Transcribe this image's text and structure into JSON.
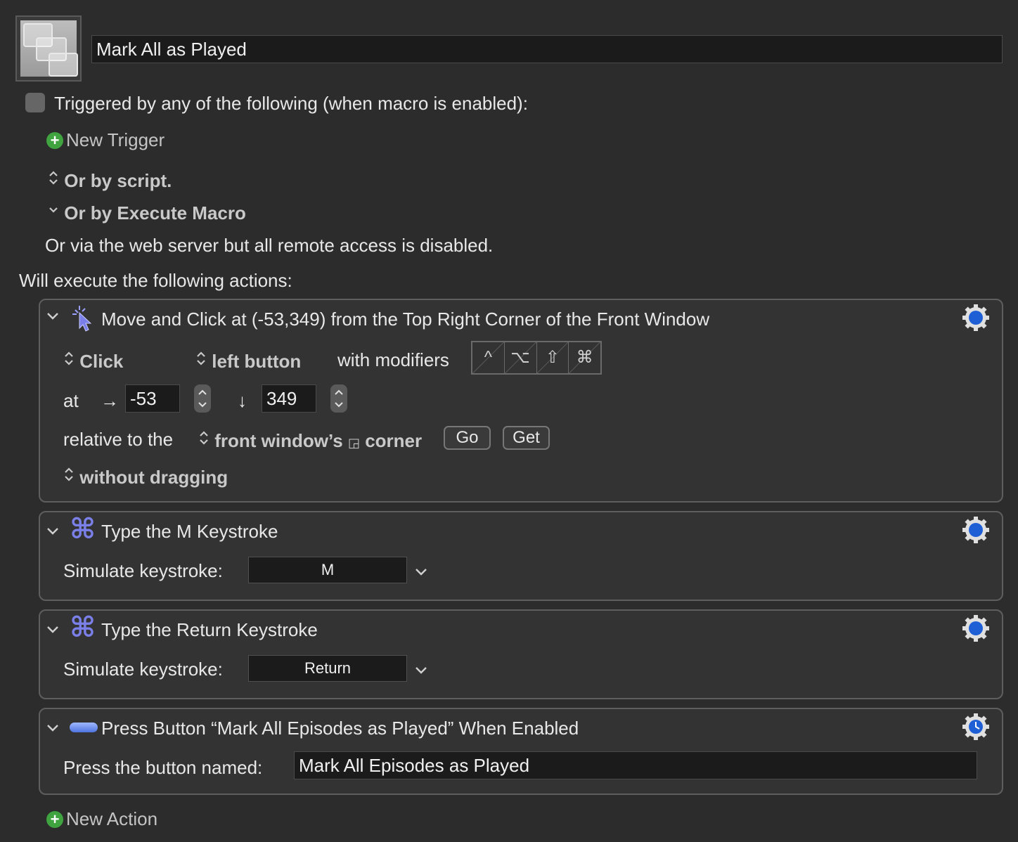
{
  "macro": {
    "name": "Mark All as Played"
  },
  "trigger": {
    "header": "Triggered by any of the following (when macro is enabled):",
    "new_trigger": "New Trigger",
    "or_script": "Or by script.",
    "or_execute": "Or by Execute Macro",
    "web_server": "Or via the web server but all remote access is disabled."
  },
  "actions_header": "Will execute the following actions:",
  "actions": [
    {
      "title": "Move and Click at (-53,349) from the Top Right Corner of the Front Window",
      "click_type": "Click",
      "mouse_button": "left button",
      "modifiers_label": "with modifiers",
      "modifier_keys": [
        "^",
        "⌥",
        "⇧",
        "⌘"
      ],
      "at_label": "at",
      "x_arrow": "→",
      "x_value": "-53",
      "y_arrow": "↓",
      "y_value": "349",
      "relative_label": "relative to the",
      "relative_target": "front window’s",
      "corner_glyph": "◲",
      "corner_label": "corner",
      "go": "Go",
      "get": "Get",
      "drag": "without dragging"
    },
    {
      "title": "Type the M Keystroke",
      "label": "Simulate keystroke:",
      "key": "M"
    },
    {
      "title": "Type the Return Keystroke",
      "label": "Simulate keystroke:",
      "key": "Return"
    },
    {
      "title": "Press Button “Mark All Episodes as Played” When Enabled",
      "label": "Press the button named:",
      "value": "Mark All Episodes as Played"
    }
  ],
  "new_action": "New Action",
  "icons": {
    "chevron": "⌄",
    "cmd": "⌘",
    "updown": "⬍",
    "plus": "+"
  },
  "colors": {
    "accent_blue": "#1f5fd6",
    "green": "#3fa33f",
    "cmd_purple": "#7b7fe8"
  }
}
